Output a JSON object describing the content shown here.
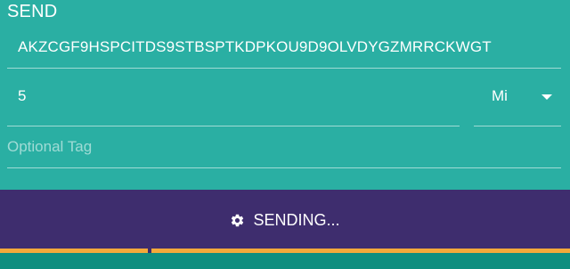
{
  "header": {
    "title": "SEND"
  },
  "form": {
    "address_value": "AKZCGF9HSPCITDS9STBSPTKDPKOU9D9OLVDYGZMRRCKWGT",
    "amount_value": "5",
    "unit_selected": "Mi",
    "tag_placeholder": "Optional Tag",
    "tag_value": ""
  },
  "send_button": {
    "label": "SENDING...",
    "icon": "gear-icon"
  },
  "progress": {
    "fraction": 0.26
  },
  "colors": {
    "panel": "#2aafa3",
    "button": "#3e2d6e",
    "progress": "#f4a93a",
    "footer": "#0f8e7f"
  }
}
